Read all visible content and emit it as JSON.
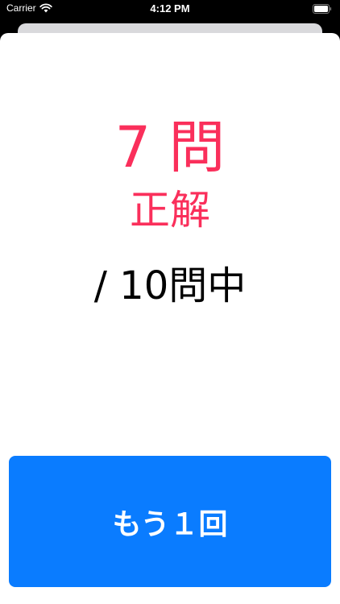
{
  "status_bar": {
    "carrier": "Carrier",
    "time": "4:12 PM",
    "wifi_icon": "wifi-icon",
    "battery_icon": "battery-icon"
  },
  "result": {
    "count": "7 問",
    "correct_label": "正解",
    "total": "/ 10問中"
  },
  "retry_button": {
    "label": "もう１回"
  },
  "colors": {
    "accent_pink": "#fa2f5b",
    "button_blue": "#0a7cff",
    "background_dark": "#000000"
  }
}
